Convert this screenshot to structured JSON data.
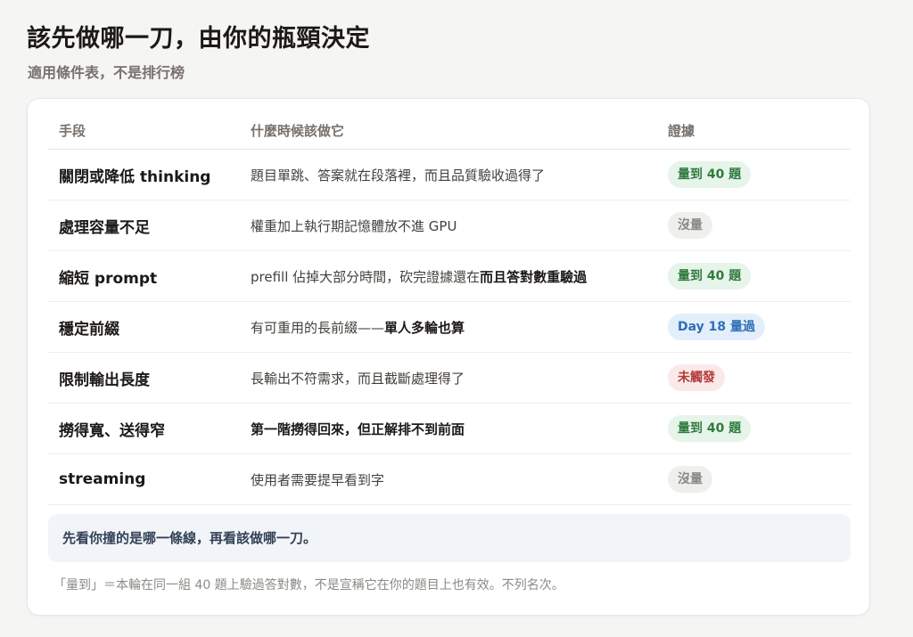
{
  "header": {
    "title": "該先做哪一刀，由你的瓶頸決定",
    "subtitle": "適用條件表，不是排行榜"
  },
  "table": {
    "columns": [
      "手段",
      "什麼時候該做它",
      "證據"
    ],
    "rows": [
      {
        "technique": "關閉或降低 thinking",
        "when_plain": "題目單跳、答案就在段落裡，而且品質驗收過得了",
        "when_bold": "",
        "evidence": "量到 40 題",
        "evidence_color": "#2f7a3f"
      },
      {
        "technique": "處理容量不足",
        "when_plain": "權重加上執行期記憶體放不進 GPU",
        "when_bold": "",
        "evidence": "沒量",
        "evidence_color": "#8a8a85"
      },
      {
        "technique": "縮短 prompt",
        "when_plain": "prefill 佔掉大部分時間，砍完證據還在",
        "when_bold": "而且答對數重驗過",
        "evidence": "量到 40 題",
        "evidence_color": "#2f7a3f"
      },
      {
        "technique": "穩定前綴",
        "when_plain": "有可重用的長前綴——",
        "when_bold": "單人多輪也算",
        "evidence": "Day 18 量過",
        "evidence_color": "#2f6fb5"
      },
      {
        "technique": "限制輸出長度",
        "when_plain": "長輸出不符需求，而且截斷處理得了",
        "when_bold": "",
        "evidence": "未觸發",
        "evidence_color": "#b23a3a"
      },
      {
        "technique": "撈得寬、送得窄",
        "when_plain": "",
        "when_bold": "第一階撈得回來，但正解排不到前面",
        "evidence": "量到 40 題",
        "evidence_color": "#2f7a3f"
      },
      {
        "technique": "streaming",
        "when_plain": "使用者需要提早看到字",
        "when_bold": "",
        "evidence": "沒量",
        "evidence_color": "#8a8a85"
      }
    ]
  },
  "callout": "先看你撞的是哪一條線，再看該做哪一刀。",
  "footnote": "「量到」＝本輪在同一組 40 題上驗過答對數，不是宣稱它在你的題目上也有效。不列名次。"
}
